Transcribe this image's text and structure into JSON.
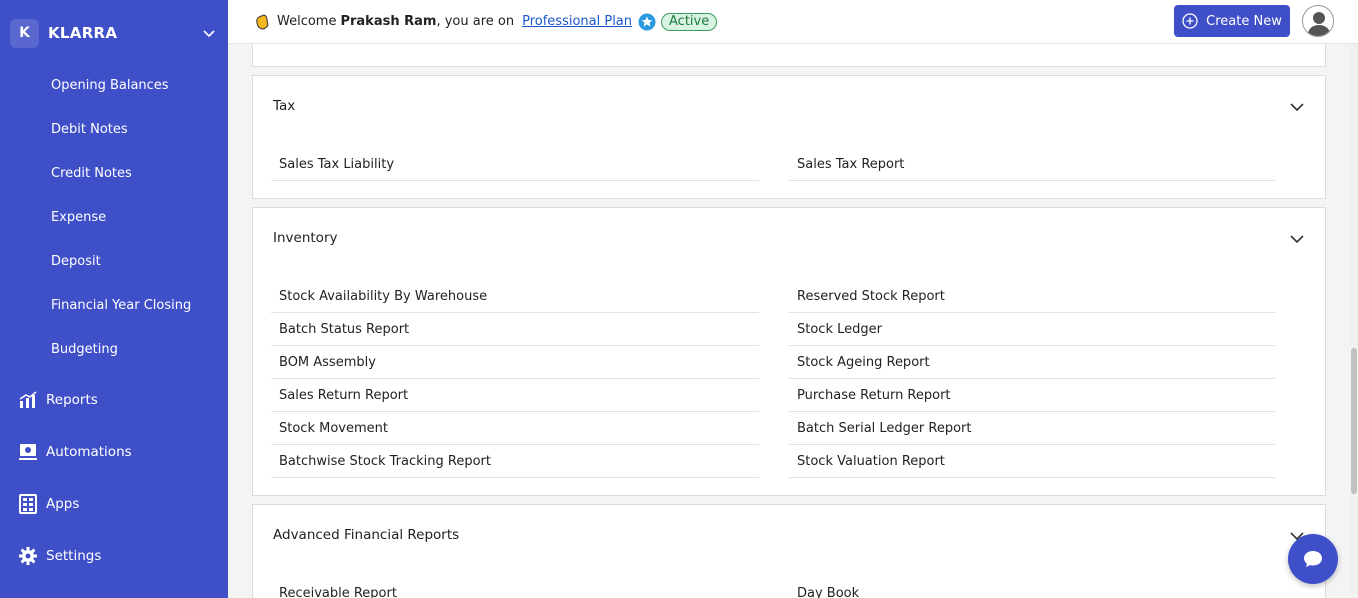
{
  "brand": {
    "initial": "K",
    "name": "KLARRA"
  },
  "sidebar": {
    "sub_items": [
      {
        "label": "Opening Balances"
      },
      {
        "label": "Debit Notes"
      },
      {
        "label": "Credit Notes"
      },
      {
        "label": "Expense"
      },
      {
        "label": "Deposit"
      },
      {
        "label": "Financial Year Closing"
      },
      {
        "label": "Budgeting"
      }
    ],
    "main_items": [
      {
        "label": "Reports",
        "icon": "reports-chart-icon"
      },
      {
        "label": "Automations",
        "icon": "automations-icon"
      },
      {
        "label": "Apps",
        "icon": "apps-grid-icon"
      },
      {
        "label": "Settings",
        "icon": "gear-icon"
      }
    ]
  },
  "header": {
    "welcome_prefix": "Welcome",
    "user_name": "Prakash Ram",
    "welcome_suffix": ", you are on",
    "plan_name": "Professional Plan",
    "status": "Active",
    "create_label": "Create New"
  },
  "sections": {
    "tax": {
      "title": "Tax",
      "left": [
        "Sales Tax Liability"
      ],
      "right": [
        "Sales Tax Report"
      ]
    },
    "inventory": {
      "title": "Inventory",
      "left": [
        "Stock Availability By Warehouse",
        "Batch Status Report",
        "BOM Assembly",
        "Sales Return Report",
        "Stock Movement",
        "Batchwise Stock Tracking Report"
      ],
      "right": [
        "Reserved Stock Report",
        "Stock Ledger",
        "Stock Ageing Report",
        "Purchase Return Report",
        "Batch Serial Ledger Report",
        "Stock Valuation Report"
      ]
    },
    "advanced": {
      "title": "Advanced Financial Reports",
      "left": [
        "Receivable Report"
      ],
      "right": [
        "Day Book"
      ]
    }
  },
  "colors": {
    "primary": "#3f4fc8",
    "active_green": "#1f7a3f",
    "link_blue": "#1a56c9"
  }
}
